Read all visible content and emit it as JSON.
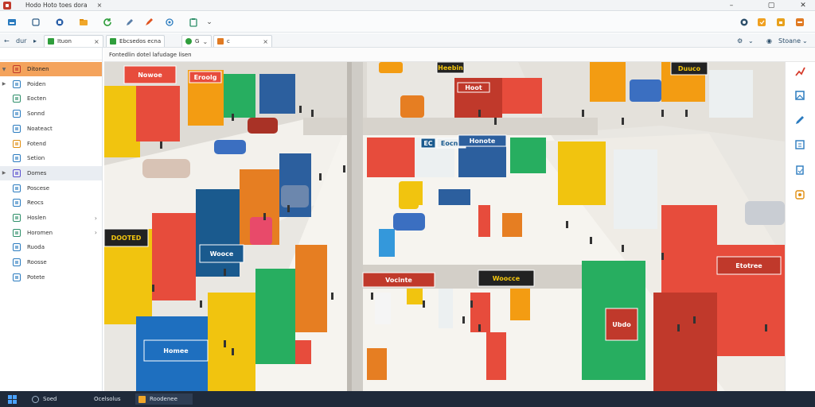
{
  "window": {
    "title": "Hodo Hoto toes dora",
    "close_tab_glyph": "×",
    "minimize_glyph": "–",
    "restore_glyph": "▢",
    "close_glyph": "✕"
  },
  "toolbar": {
    "icons": [
      "inbox-icon",
      "copy-icon",
      "stack-icon",
      "folder-icon",
      "refresh-icon",
      "edit-icon",
      "pen-icon",
      "share-icon",
      "clipboard-icon"
    ],
    "right_icons": [
      "help-icon",
      "star-icon",
      "lock-icon",
      "exit-icon"
    ],
    "dropdown_glyph": "⌄"
  },
  "nav": {
    "back_label": "dur",
    "search_label": "Stoane",
    "tabs": [
      {
        "label": "Ituon",
        "close": "×"
      },
      {
        "label": "Ebcsedos ecna",
        "close": ""
      },
      {
        "label": "G",
        "close": ""
      },
      {
        "label": "c",
        "close": "×"
      }
    ]
  },
  "sidebar": {
    "items": [
      {
        "label": "Ditonen",
        "has_children": true,
        "expanded": true,
        "active": true
      },
      {
        "label": "Poiden",
        "has_children": true,
        "expanded": false
      },
      {
        "label": "Eocten"
      },
      {
        "label": "Sonnd"
      },
      {
        "label": "Noateact"
      },
      {
        "label": "Fotend"
      },
      {
        "label": "Setion"
      },
      {
        "label": "Domes",
        "has_children": true,
        "selected": true
      },
      {
        "label": "Poscese"
      },
      {
        "label": "Reocs"
      },
      {
        "label": "Hoslen",
        "chevron": "›"
      },
      {
        "label": "Horomen",
        "chevron": "›"
      },
      {
        "label": "Ruoda"
      },
      {
        "label": "Roosse"
      },
      {
        "label": "Potete"
      }
    ]
  },
  "content": {
    "breadcrumb": "Fontedlin dotel lafudage lisen",
    "store_signs": [
      "Nowoe",
      "Eroolg",
      "Eocnc",
      "EC",
      "Honote",
      "Hoot",
      "Duuco",
      "Heebin",
      "Vocinte",
      "Woocce",
      "DOOTED",
      "Wooce",
      "Homee",
      "Ubdo",
      "Etotree"
    ]
  },
  "taskbar": {
    "items": [
      {
        "label": "Soed"
      },
      {
        "label": "Ocelsolus"
      },
      {
        "label": "Roodenee",
        "active": true
      }
    ]
  }
}
